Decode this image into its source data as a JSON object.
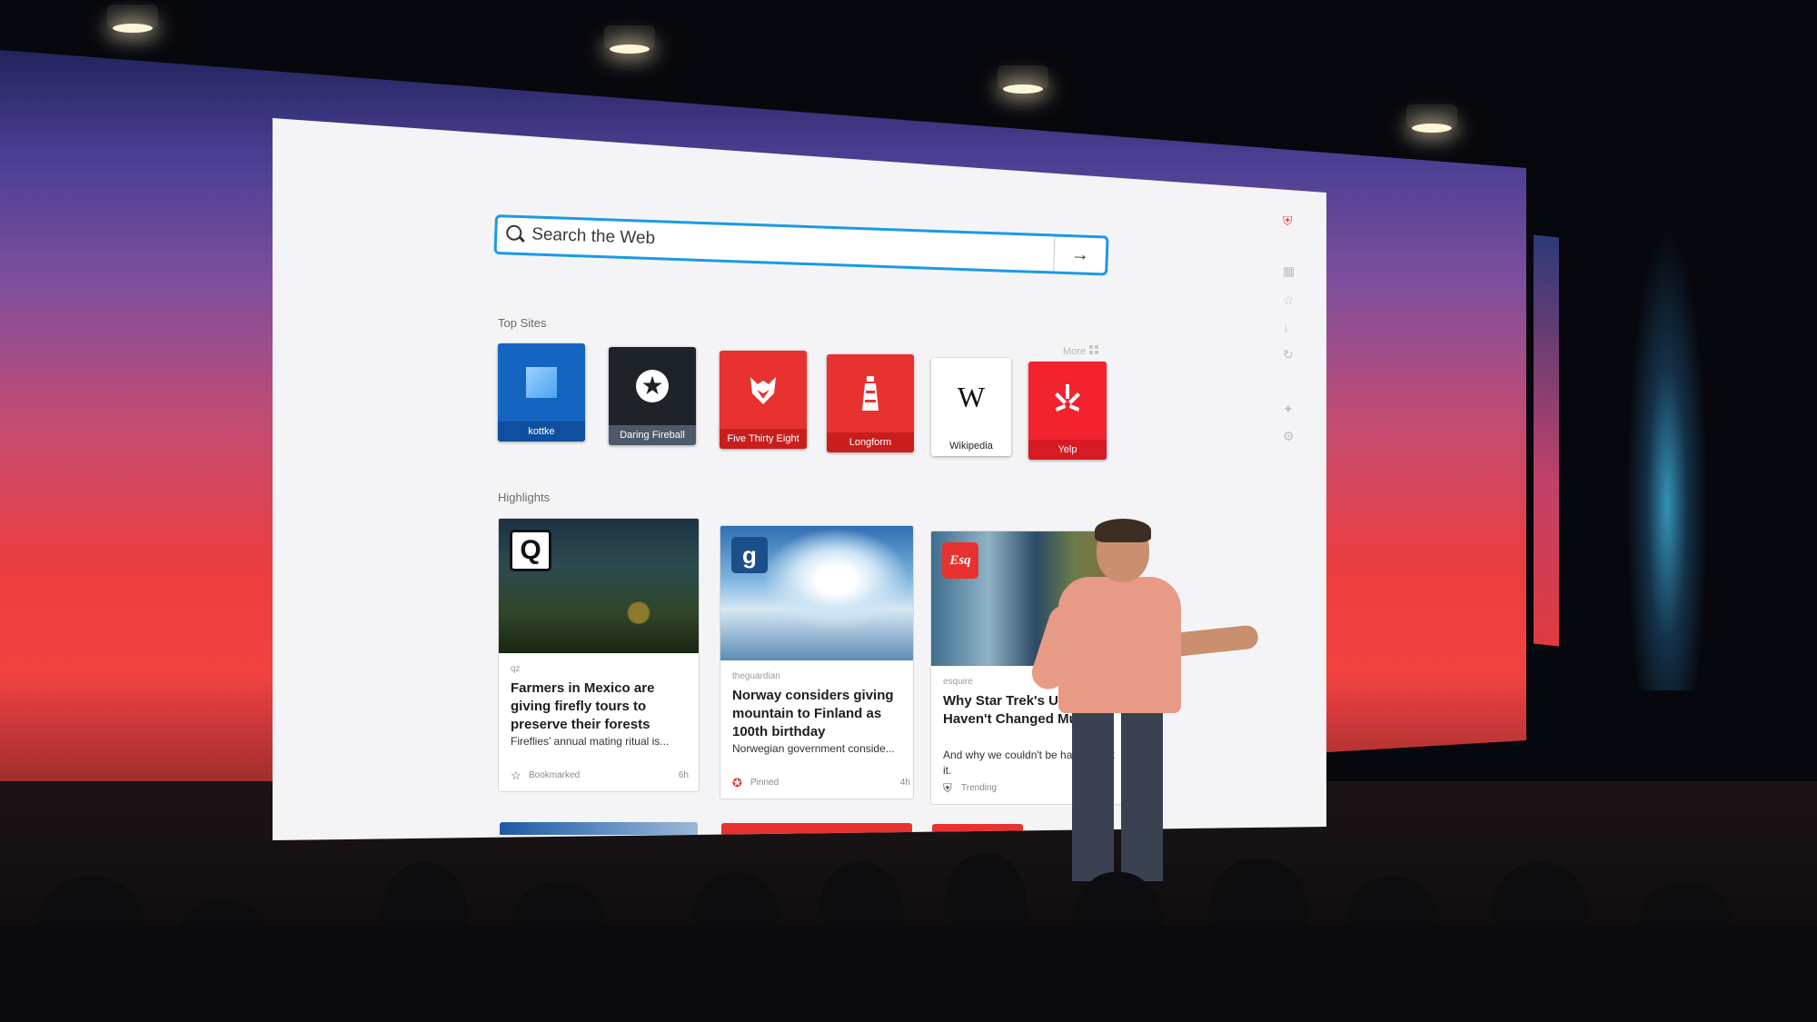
{
  "search": {
    "placeholder": "Search the Web"
  },
  "top_sites": {
    "label": "Top Sites",
    "more_label": "More",
    "items": [
      {
        "label": "kottke",
        "color": "#1565c0",
        "icon": "square-icon"
      },
      {
        "label": "Daring Fireball",
        "color": "#1d2329",
        "icon": "star-icon"
      },
      {
        "label": "Five Thirty Eight",
        "color": "#e8322f",
        "icon": "fox-icon"
      },
      {
        "label": "Longform",
        "color": "#e8322f",
        "icon": "lighthouse-icon"
      },
      {
        "label": "Wikipedia",
        "color": "#ffffff",
        "icon": "wikipedia-w-icon",
        "glyph": "W"
      },
      {
        "label": "Yelp",
        "color": "#f2232e",
        "icon": "yelp-burst-icon"
      }
    ]
  },
  "highlights": {
    "label": "Highlights",
    "items": [
      {
        "source": "qz",
        "badge": "Q",
        "title": "Farmers in Mexico are giving firefly tours to preserve their forests",
        "desc": "Fireflies’ annual mating ritual is...",
        "status": "Bookmarked",
        "status_icon": "star-icon",
        "age": "6h"
      },
      {
        "source": "theguardian",
        "badge": "g",
        "title": "Norway considers giving mountain to Finland as 100th  birthday",
        "desc": "Norwegian government conside...",
        "status": "Pinned",
        "status_icon": "pin-icon",
        "age": "4h"
      },
      {
        "source": "esquire",
        "badge": "Esq",
        "title": "Why Star Trek's Uniform Haven't Changed Much",
        "desc": "And why we couldn't be happ about it.",
        "status": "Trending",
        "status_icon": "pocket-icon",
        "age": ""
      }
    ]
  },
  "colors": {
    "accent": "#1a9ae6",
    "stage_red": "#ec3d3e",
    "stage_purple": "#4b3f93"
  }
}
